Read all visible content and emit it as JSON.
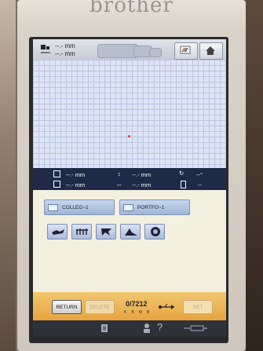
{
  "device": {
    "logo_text": "brother"
  },
  "top_bar": {
    "width_value": "--.- mm",
    "height_value": "--.- mm",
    "palette_icon": "color-palette-icon",
    "home_icon": "home-icon"
  },
  "info_bar": {
    "row1": {
      "size_value": "--.- mm",
      "vertical_value": "--.- mm",
      "rotate_value": "--°"
    },
    "row2": {
      "size_value": "--.- mm",
      "horizontal_value": "--.- mm",
      "density_value": "--"
    }
  },
  "folders": [
    {
      "label": "COLLEG~1"
    },
    {
      "label": "PORTFO~1"
    }
  ],
  "pattern_icons": [
    "embroidery-pattern-1-icon",
    "embroidery-pattern-2-icon",
    "embroidery-pattern-3-icon",
    "embroidery-pattern-4-icon",
    "embroidery-pattern-5-icon"
  ],
  "bottom_bar": {
    "return_label": "RETURN",
    "delete_label": "DELETE",
    "set_label": "SET",
    "memory_used": "0",
    "memory_total": "7212",
    "memory_units_kb": "KB",
    "memory_units_mb": "MB",
    "usb_icon": "usb-icon"
  },
  "hardware_bar": {
    "help_symbol": "?"
  },
  "colors": {
    "grid_background": "#dde4f3",
    "info_bar": "#1e2a48",
    "folder_area": "#f3f0e0",
    "bottom_bar": "#e7a440"
  }
}
